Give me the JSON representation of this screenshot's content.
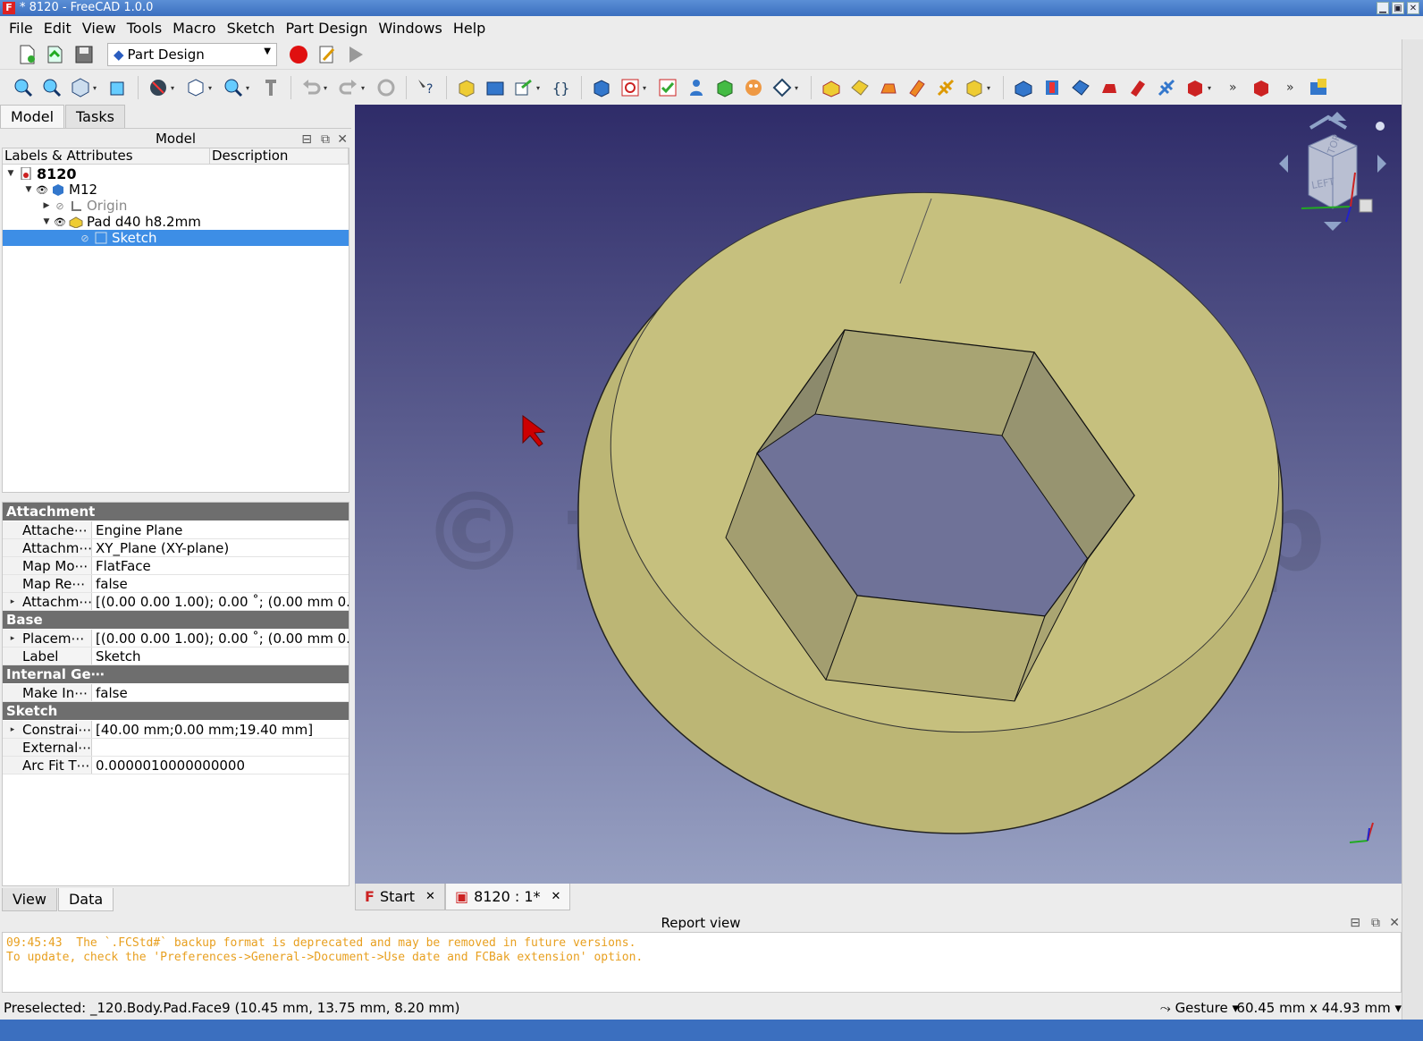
{
  "window": {
    "title": "* 8120 - FreeCAD 1.0.0",
    "app_icon": "F"
  },
  "menubar": [
    "File",
    "Edit",
    "View",
    "Tools",
    "Macro",
    "Sketch",
    "Part Design",
    "Windows",
    "Help"
  ],
  "toolbar": {
    "workbench": "Part Design"
  },
  "left_tabs": [
    "Model",
    "Tasks"
  ],
  "model_panel": {
    "title": "Model",
    "columns": [
      "Labels & Attributes",
      "Description"
    ],
    "tree": {
      "root": "8120",
      "body": "M12",
      "origin": "Origin",
      "pad": "Pad d40 h8.2mm",
      "sketch": "Sketch"
    }
  },
  "properties": {
    "groups": [
      {
        "name": "Attachment",
        "rows": [
          {
            "expand": "",
            "name": "Attache⋯",
            "value": "Engine Plane"
          },
          {
            "expand": "",
            "name": "Attachm⋯",
            "value": "XY_Plane (XY-plane)"
          },
          {
            "expand": "",
            "name": "Map Mo⋯",
            "value": "FlatFace"
          },
          {
            "expand": "",
            "name": "Map Re⋯",
            "value": "false"
          },
          {
            "expand": "▸",
            "name": "Attachm⋯",
            "value": "[(0.00 0.00 1.00); 0.00 ˚; (0.00 mm  0.⋯"
          }
        ]
      },
      {
        "name": "Base",
        "rows": [
          {
            "expand": "▸",
            "name": "Placem⋯",
            "value": "[(0.00 0.00 1.00); 0.00 ˚; (0.00 mm  0.⋯"
          },
          {
            "expand": "",
            "name": "Label",
            "value": "Sketch"
          }
        ]
      },
      {
        "name": "Internal Ge⋯",
        "rows": [
          {
            "expand": "",
            "name": "Make In⋯",
            "value": "false"
          }
        ]
      },
      {
        "name": "Sketch",
        "rows": [
          {
            "expand": "▸",
            "name": "Constrai⋯",
            "value": "[40.00 mm;0.00 mm;19.40 mm]"
          },
          {
            "expand": "",
            "name": "External⋯",
            "value": ""
          },
          {
            "expand": "",
            "name": "Arc Fit T⋯",
            "value": "0.0000010000000000"
          }
        ]
      }
    ]
  },
  "bottom_tabs": [
    "View",
    "Data"
  ],
  "view_tabs": [
    {
      "label": "Start"
    },
    {
      "label": "8120 : 1*"
    }
  ],
  "navcube": {
    "top": "TOP",
    "left": "LEFT"
  },
  "watermark": "© fisherman.jp",
  "report": {
    "title": "Report view",
    "lines": [
      "09:45:43  The `.FCStd#` backup format is deprecated and may be removed in future versions.",
      "To update, check the 'Preferences->General->Document->Use date and FCBak extension' option."
    ]
  },
  "status": {
    "message": "Preselected: _120.Body.Pad.Face9 (10.45 mm, 13.75 mm, 8.20 mm)",
    "navigation": "Gesture",
    "dimensions": "60.45 mm x 44.93 mm"
  },
  "colors": {
    "selection": "#3d8ee6",
    "model_face": "#c6c07e",
    "report_text": "#e8a020",
    "record_button": "#e01010"
  }
}
